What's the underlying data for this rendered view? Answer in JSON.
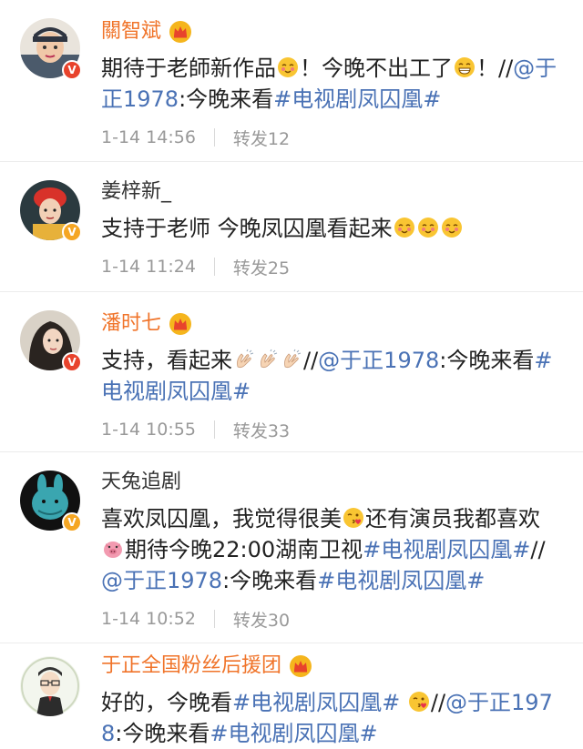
{
  "comments": [
    {
      "username": "關智斌",
      "vip": true,
      "badge": "V",
      "avatar_icon": "man-avatar",
      "content_parts": [
        {
          "type": "text",
          "value": "期待于老師新作品"
        },
        {
          "type": "emoji",
          "name": "blush-emoji"
        },
        {
          "type": "text",
          "value": "！今晚不出工了"
        },
        {
          "type": "emoji",
          "name": "grin-emoji"
        },
        {
          "type": "text",
          "value": "！//"
        },
        {
          "type": "link",
          "value": "@于正1978"
        },
        {
          "type": "text",
          "value": ":今晚来看"
        },
        {
          "type": "link",
          "value": "#电视剧凤囚凰#"
        }
      ],
      "time": "1-14 14:56",
      "repost": "转发12"
    },
    {
      "username": "姜梓新_",
      "vip": false,
      "badge": "V",
      "avatar_icon": "woman-red-hair-avatar",
      "content_parts": [
        {
          "type": "text",
          "value": "支持于老师 今晚凤囚凰看起来"
        },
        {
          "type": "emoji",
          "name": "blush-emoji"
        },
        {
          "type": "emoji",
          "name": "blush-emoji"
        },
        {
          "type": "emoji",
          "name": "blush-emoji"
        }
      ],
      "time": "1-14 11:24",
      "repost": "转发25"
    },
    {
      "username": "潘时七",
      "vip": true,
      "badge": "V",
      "avatar_icon": "woman-avatar",
      "content_parts": [
        {
          "type": "text",
          "value": "支持，看起来"
        },
        {
          "type": "emoji",
          "name": "clap-emoji"
        },
        {
          "type": "emoji",
          "name": "clap-emoji"
        },
        {
          "type": "emoji",
          "name": "clap-emoji"
        },
        {
          "type": "text",
          "value": "//"
        },
        {
          "type": "link",
          "value": "@于正1978"
        },
        {
          "type": "text",
          "value": ":今晚来看"
        },
        {
          "type": "link",
          "value": "#电视剧凤囚凰#"
        }
      ],
      "time": "1-14 10:55",
      "repost": "转发33"
    },
    {
      "username": "天兔追剧",
      "vip": false,
      "badge": "V",
      "avatar_icon": "rabbit-avatar",
      "content_parts": [
        {
          "type": "text",
          "value": "喜欢凤囚凰，我觉得很美"
        },
        {
          "type": "emoji",
          "name": "kiss-emoji"
        },
        {
          "type": "text",
          "value": "还有演员我都喜欢"
        },
        {
          "type": "emoji",
          "name": "pig-emoji"
        },
        {
          "type": "text",
          "value": "期待今晚22:00湖南卫视"
        },
        {
          "type": "link",
          "value": "#电视剧凤囚凰#"
        },
        {
          "type": "text",
          "value": "//"
        },
        {
          "type": "link",
          "value": "@于正1978"
        },
        {
          "type": "text",
          "value": ":今晚来看"
        },
        {
          "type": "link",
          "value": "#电视剧凤囚凰#"
        }
      ],
      "time": "1-14 10:52",
      "repost": "转发30"
    },
    {
      "username": "于正全国粉丝后援团",
      "vip": true,
      "badge": "",
      "avatar_icon": "cartoon-man-avatar",
      "content_parts": [
        {
          "type": "text",
          "value": "好的，今晚看"
        },
        {
          "type": "link",
          "value": "#电视剧凤囚凰#"
        },
        {
          "type": "text",
          "value": " "
        },
        {
          "type": "emoji",
          "name": "kiss-emoji"
        },
        {
          "type": "text",
          "value": "//"
        },
        {
          "type": "link",
          "value": "@于正1978"
        },
        {
          "type": "text",
          "value": ":今晚来看"
        },
        {
          "type": "link",
          "value": "#电视剧凤囚凰#"
        }
      ],
      "time": "",
      "repost": ""
    }
  ],
  "colors": {
    "vip_name": "#f0742a",
    "link": "#4a72b5",
    "meta": "#999999",
    "badge_red": "#e8432c",
    "badge_gold": "#f5a623"
  }
}
